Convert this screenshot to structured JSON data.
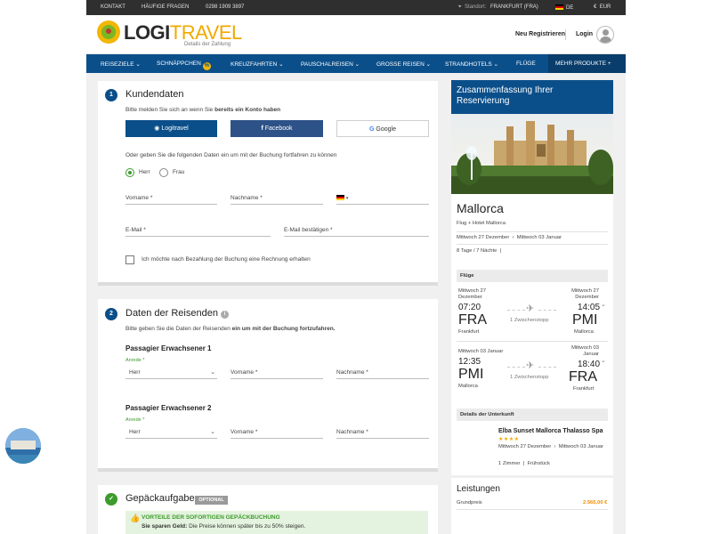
{
  "topbar": {
    "contact": "KONTAKT",
    "faq": "HÄUFIGE FRAGEN",
    "phone": "0298 1909 3897",
    "location_label": "Standort:",
    "location_value": "FRANKFURT (FRA)",
    "language": "DE",
    "currency": "EUR"
  },
  "header": {
    "logo_part1": "LOGI",
    "logo_part2": "TRAVEL",
    "logo_subtitle": "Details der Zahlung",
    "register": "Neu Registrieren",
    "login": "Login"
  },
  "nav": {
    "items": [
      "REISEZIELE",
      "SCHNÄPPCHEN",
      "KREUZFAHRTEN",
      "PAUSCHALREISEN",
      "GROSSE REISEN",
      "STRANDHOTELS",
      "FLÜGE",
      "MEHR PRODUKTE"
    ],
    "badge": "%"
  },
  "kunde": {
    "step": "1",
    "title": "Kundendaten",
    "login_hint_1": "Bitte melden Sie sich an wenn Sie ",
    "login_hint_bold": "bereits ein Konto haben",
    "btn_logitravel": "Logitravel",
    "btn_facebook": "Facebook",
    "btn_google": "Google",
    "or_text": "Oder geben Sie die folgenden Daten ein um mit der Buchung fortfahren zu können",
    "radio_herr": "Herr",
    "radio_frau": "Frau",
    "vorname": "Vorname *",
    "nachname": "Nachname *",
    "email": "E-Mail *",
    "email_confirm": "E-Mail bestätigen *",
    "invoice_check": "Ich möchte nach Bezahlung der Buchung eine Rechnung erhalten"
  },
  "reisende": {
    "step": "2",
    "title": "Daten der Reisenden",
    "hint_1": "Bitte geben Sie die Daten der Reisenden ",
    "hint_bold": "ein um mit der Buchung fortzufahren.",
    "passengers": [
      {
        "title": "Passagier Erwachsener 1",
        "anrede": "Anrede *",
        "salutation": "Herr",
        "vorname": "Vorname *",
        "nachname": "Nachname *"
      },
      {
        "title": "Passagier Erwachsener 2",
        "anrede": "Anrede *",
        "salutation": "Herr",
        "vorname": "Vorname *",
        "nachname": "Nachname *"
      }
    ]
  },
  "gepaeck": {
    "title": "Gepäckaufgabe",
    "badge": "OPTIONAL",
    "promo_title": "VORTEILE DER SOFORTIGEN GEPÄCKBUCHUNG",
    "promo_bold": "Sie sparen Geld:",
    "promo_text": " Die Preise können später bis zu 50% steigen."
  },
  "summary": {
    "title": "Zusammenfassung Ihrer Reservierung",
    "city": "Mallorca",
    "package": "Flug + Hotel Mallorca",
    "date_from": "Mittwoch 27 Dezember",
    "date_to": "Mittwoch 03 Januar",
    "duration": "8 Tage / 7 Nächte",
    "flights_label": "Flüge",
    "flights": [
      {
        "dep_date": "Mittwoch 27 Dezember",
        "dep_time": "07:20",
        "dep_code": "FRA",
        "dep_city": "Frankfurt",
        "stops": "1 Zwischenstopp",
        "arr_date": "Mittwoch 27 Dezember",
        "arr_time": "14:05",
        "arr_code": "PMI",
        "arr_city": "Mallorca"
      },
      {
        "dep_date": "Mittwoch 03 Januar",
        "dep_time": "12:35",
        "dep_code": "PMI",
        "dep_city": "Mallorca",
        "stops": "1 Zwischenstopp",
        "arr_date": "Mittwoch 03 Januar",
        "arr_time": "18:40",
        "arr_code": "FRA",
        "arr_city": "Frankfurt"
      }
    ],
    "hotel_label": "Details der Unterkunft",
    "hotel_name": "Elba Sunset Mallorca Thalasso Spa",
    "hotel_stars": "★★★★",
    "hotel_date_from": "Mittwoch 27 Dezember",
    "hotel_date_to": "Mittwoch 03 Januar",
    "hotel_room": "1 Zimmer",
    "hotel_board": "Frühstück",
    "services_title": "Leistungen",
    "base_price_label": "Grundpreis",
    "base_price_value": "2.565,00 €"
  }
}
